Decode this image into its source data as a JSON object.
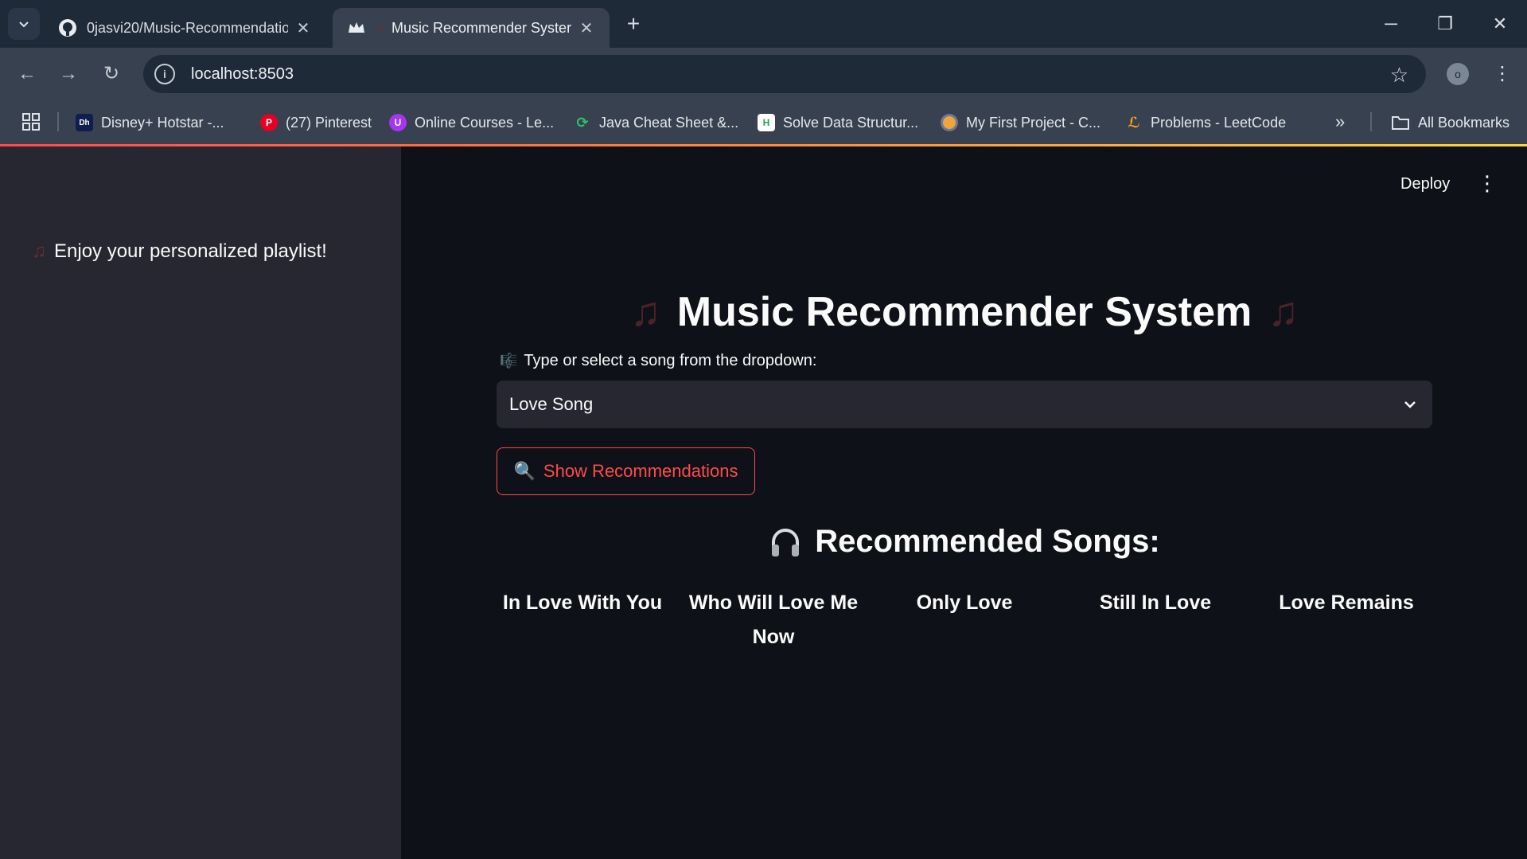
{
  "browser": {
    "tabs": [
      {
        "title": "0jasvi20/Music-Recommendatio",
        "favicon": "github-icon",
        "active": false
      },
      {
        "title": "Music Recommender Syster",
        "favicon": "streamlit-crown-icon",
        "active": true
      }
    ],
    "url": "localhost:8503",
    "profile_initial": "o",
    "bookmarks": [
      {
        "label": "Disney+ Hotstar -...",
        "icon": "hotstar-icon"
      },
      {
        "label": "(27) Pinterest",
        "icon": "pinterest-icon"
      },
      {
        "label": "Online Courses - Le...",
        "icon": "udemy-icon"
      },
      {
        "label": "Java Cheat Sheet &...",
        "icon": "javacheat-icon"
      },
      {
        "label": "Solve Data Structur...",
        "icon": "hackerrank-icon"
      },
      {
        "label": "My First Project - C...",
        "icon": "project-icon"
      },
      {
        "label": "Problems - LeetCode",
        "icon": "leetcode-icon"
      }
    ],
    "all_bookmarks_label": "All Bookmarks"
  },
  "sidebar": {
    "message": "Enjoy your personalized playlist!"
  },
  "header": {
    "deploy_label": "Deploy"
  },
  "main": {
    "title": "Music Recommender System",
    "select_label": "Type or select a song from the dropdown:",
    "selected_song": "Love Song",
    "button_label": "Show Recommendations",
    "recommended_heading": "Recommended Songs:",
    "songs": [
      "In Love With You",
      "Who Will Love Me Now",
      "Only Love",
      "Still In Love",
      "Love Remains"
    ]
  },
  "colors": {
    "accent": "#ff4b4b",
    "sidebar_bg": "#262730",
    "main_bg": "#0e1117"
  }
}
